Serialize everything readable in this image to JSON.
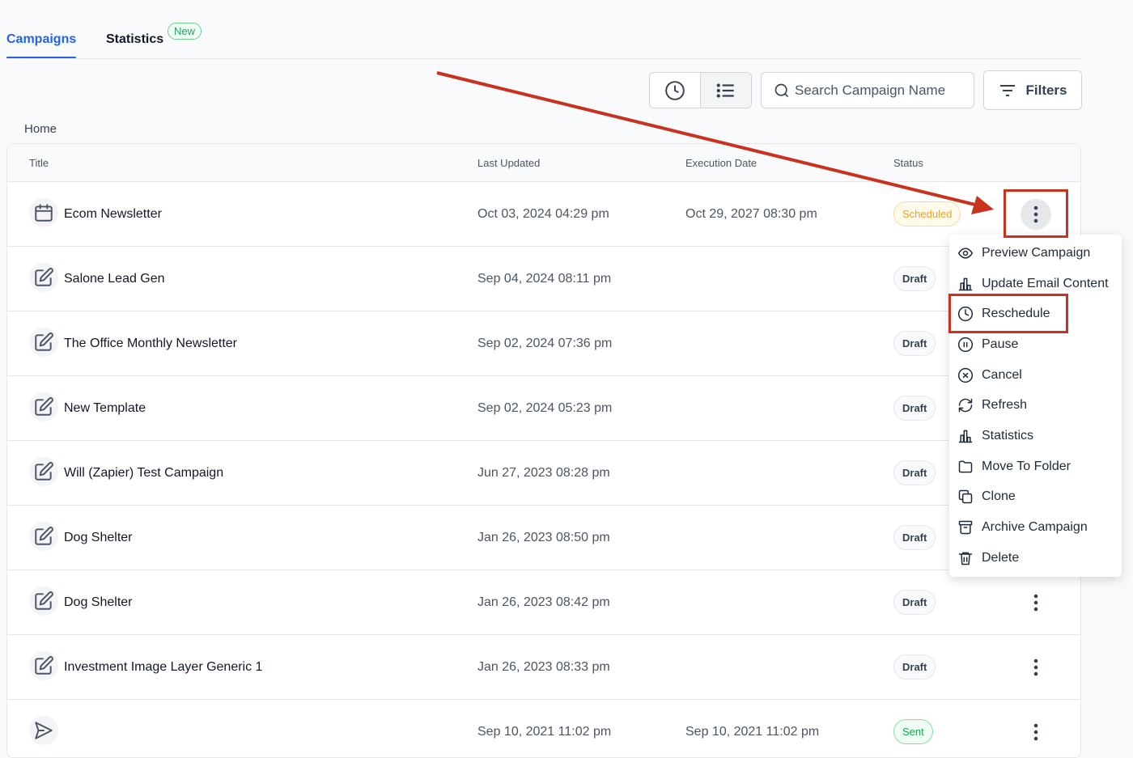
{
  "tabs": {
    "campaigns": "Campaigns",
    "statistics": "Statistics",
    "new_badge": "New"
  },
  "search": {
    "placeholder": "Search Campaign Name"
  },
  "filters_label": "Filters",
  "breadcrumb": "Home",
  "columns": {
    "title": "Title",
    "last_updated": "Last Updated",
    "execution_date": "Execution Date",
    "status": "Status"
  },
  "rows": [
    {
      "icon": "calendar",
      "title": "Ecom Newsletter",
      "last_updated": "Oct 03, 2024 04:29 pm",
      "execution_date": "Oct 29, 2027 08:30 pm",
      "status": "Scheduled"
    },
    {
      "icon": "edit",
      "title": "Salone Lead Gen",
      "last_updated": "Sep 04, 2024 08:11 pm",
      "execution_date": "",
      "status": "Draft"
    },
    {
      "icon": "edit",
      "title": "The Office Monthly Newsletter",
      "last_updated": "Sep 02, 2024 07:36 pm",
      "execution_date": "",
      "status": "Draft"
    },
    {
      "icon": "edit",
      "title": "New Template",
      "last_updated": "Sep 02, 2024 05:23 pm",
      "execution_date": "",
      "status": "Draft"
    },
    {
      "icon": "edit",
      "title": "Will (Zapier) Test Campaign",
      "last_updated": "Jun 27, 2023 08:28 pm",
      "execution_date": "",
      "status": "Draft"
    },
    {
      "icon": "edit",
      "title": "Dog Shelter",
      "last_updated": "Jan 26, 2023 08:50 pm",
      "execution_date": "",
      "status": "Draft"
    },
    {
      "icon": "edit",
      "title": "Dog Shelter",
      "last_updated": "Jan 26, 2023 08:42 pm",
      "execution_date": "",
      "status": "Draft"
    },
    {
      "icon": "edit",
      "title": "Investment Image Layer Generic 1",
      "last_updated": "Jan 26, 2023 08:33 pm",
      "execution_date": "",
      "status": "Draft"
    },
    {
      "icon": "send",
      "title": "",
      "last_updated": "Sep 10, 2021 11:02 pm",
      "execution_date": "Sep 10, 2021 11:02 pm",
      "status": "Sent"
    }
  ],
  "menu": [
    {
      "icon": "eye",
      "label": "Preview Campaign"
    },
    {
      "icon": "chart",
      "label": "Update Email Content"
    },
    {
      "icon": "clock",
      "label": "Reschedule"
    },
    {
      "icon": "pause",
      "label": "Pause"
    },
    {
      "icon": "x-circle",
      "label": "Cancel"
    },
    {
      "icon": "refresh",
      "label": "Refresh"
    },
    {
      "icon": "chart",
      "label": "Statistics"
    },
    {
      "icon": "folder",
      "label": "Move To Folder"
    },
    {
      "icon": "copy",
      "label": "Clone"
    },
    {
      "icon": "archive",
      "label": "Archive Campaign"
    },
    {
      "icon": "trash",
      "label": "Delete"
    }
  ],
  "colors": {
    "accent": "#2563eb",
    "annotation": "#c8321e"
  }
}
